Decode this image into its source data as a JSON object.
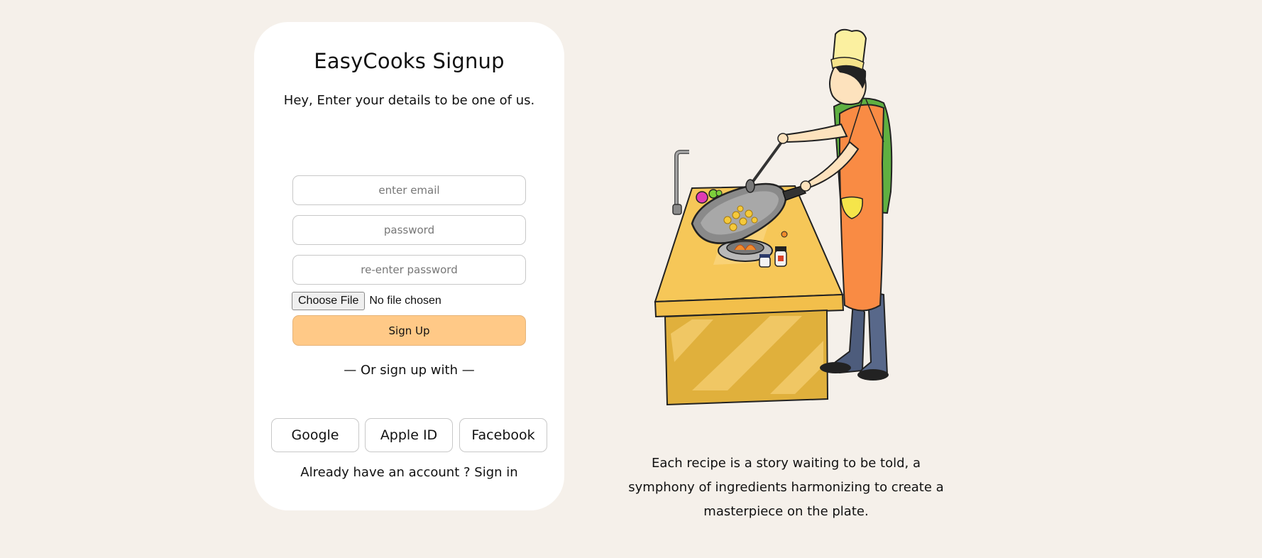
{
  "signup_card": {
    "title": "EasyCooks Signup",
    "subtitle": "Hey, Enter your details to be one of us.",
    "fields": {
      "email_placeholder": "enter email",
      "password_placeholder": "password",
      "reenter_password_placeholder": "re-enter password"
    },
    "file_input": {
      "button_label": "Choose File",
      "status": "No file chosen"
    },
    "signup_button": "Sign Up",
    "divider_text": "— Or sign up with —",
    "social_buttons": [
      "Google",
      "Apple ID",
      "Facebook"
    ],
    "signin_prompt": "Already have an account ?",
    "signin_link": "Sign in"
  },
  "illustration": {
    "icon": "chef-cooking-illustration"
  },
  "quote": "Each recipe is a story waiting to be told, a symphony of ingredients harmonizing to create a masterpiece on the plate."
}
